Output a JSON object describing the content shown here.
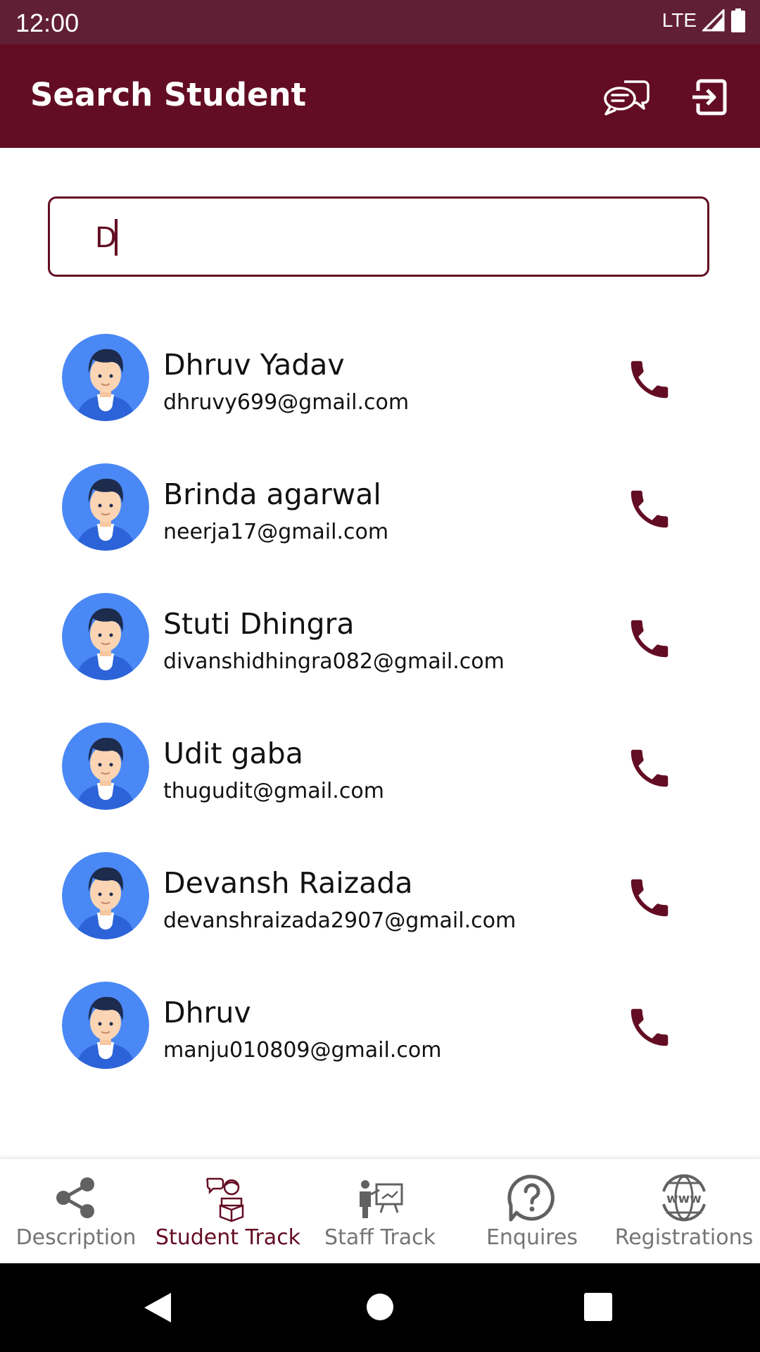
{
  "status_bar": {
    "time": "12:00",
    "network": "LTE"
  },
  "header": {
    "title": "Search Student"
  },
  "search": {
    "value": "D"
  },
  "students": [
    {
      "name": "Dhruv Yadav",
      "email": "dhruvy699@gmail.com"
    },
    {
      "name": "Brinda agarwal",
      "email": "neerja17@gmail.com"
    },
    {
      "name": "Stuti Dhingra",
      "email": "divanshidhingra082@gmail.com"
    },
    {
      "name": "Udit gaba",
      "email": "thugudit@gmail.com"
    },
    {
      "name": "Devansh Raizada",
      "email": "devanshraizada2907@gmail.com"
    },
    {
      "name": "Dhruv",
      "email": "manju010809@gmail.com"
    }
  ],
  "bottom_nav": [
    {
      "label": "Description",
      "icon": "share-icon"
    },
    {
      "label": "Student Track",
      "icon": "student-reading-icon",
      "active": true
    },
    {
      "label": "Staff Track",
      "icon": "teacher-board-icon"
    },
    {
      "label": "Enquires",
      "icon": "question-icon"
    },
    {
      "label": "Registrations",
      "icon": "www-globe-icon"
    }
  ],
  "colors": {
    "brand": "#630d24",
    "status_bar": "#611f35",
    "avatar_bg": "#4a88f5",
    "nav_inactive": "#757575"
  }
}
